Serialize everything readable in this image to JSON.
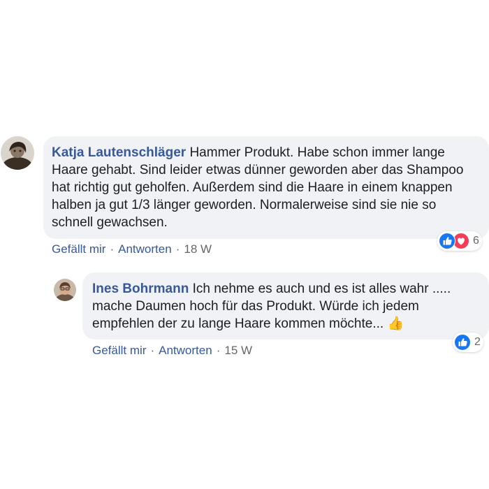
{
  "comments": [
    {
      "author": "Katja Lautenschläger",
      "text": "Hammer Produkt. Habe schon immer lange Haare gehabt. Sind leider etwas dünner geworden aber das Shampoo hat richtig gut geholfen. Außerdem sind die Haare in einem knappen halben ja gut 1/3 länger geworden. Normalerweise sind sie nie so schnell gewachsen.",
      "like_label": "Gefällt mir",
      "reply_label": "Antworten",
      "separator": "·",
      "time": "18 W",
      "reaction_icons": [
        "like-icon",
        "love-icon"
      ],
      "reaction_count": "6"
    },
    {
      "author": "Ines Bohrmann",
      "text": "Ich nehme es auch und es ist alles wahr ..... mache Daumen hoch für das Produkt. Würde ich jedem empfehlen der zu lange Haare kommen möchte...",
      "emoji": "👍",
      "like_label": "Gefällt mir",
      "reply_label": "Antworten",
      "separator": "·",
      "time": "15 W",
      "reaction_icons": [
        "like-icon"
      ],
      "reaction_count": "2"
    }
  ],
  "colors": {
    "author": "#385898",
    "bubble": "#f0f2f5",
    "meta": "#65676b",
    "like": "#1877f2",
    "love": "#f33e58"
  }
}
